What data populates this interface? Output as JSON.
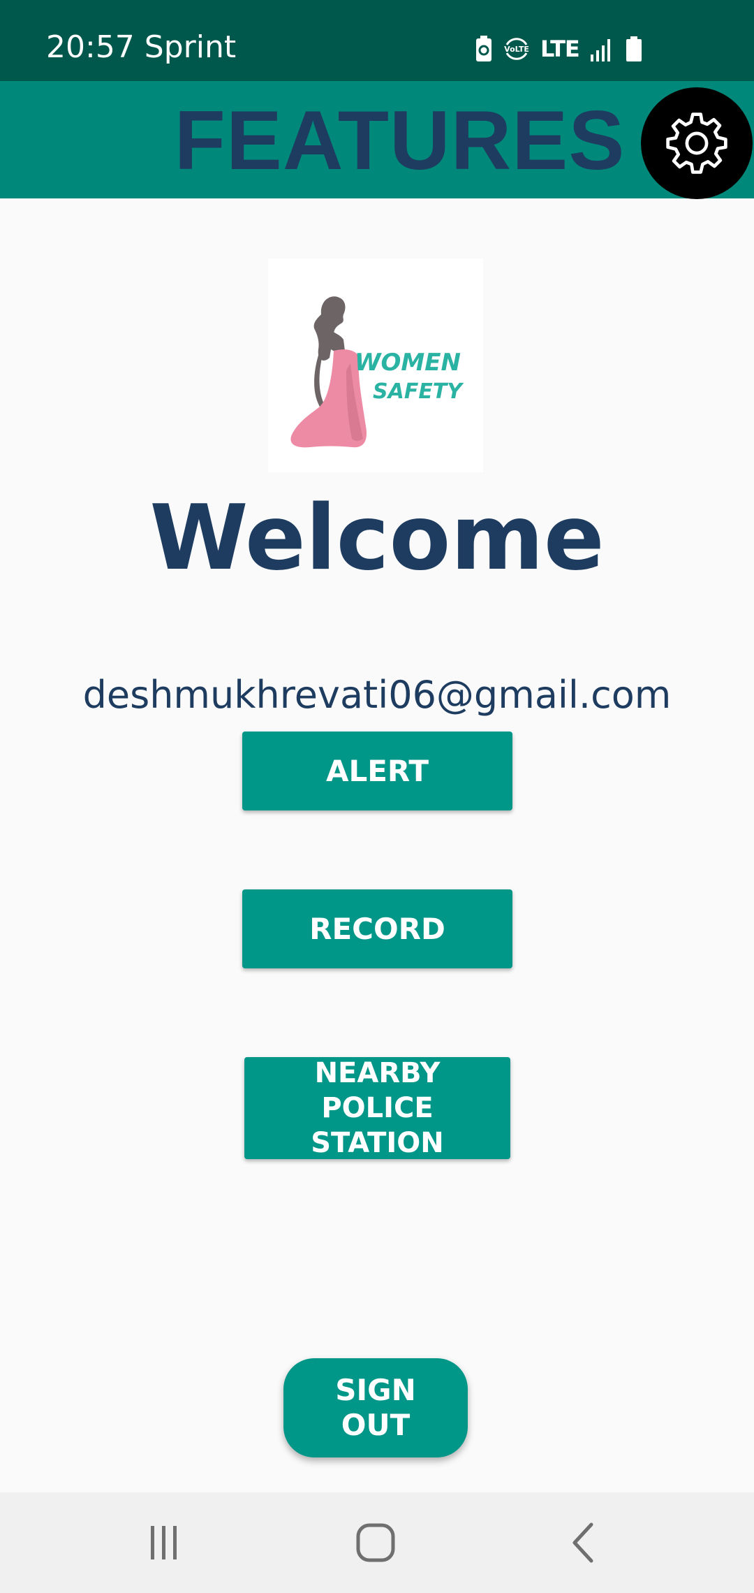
{
  "status_bar": {
    "time": "20:57 Sprint",
    "network": "LTE",
    "icons": [
      "battery-saver-icon",
      "volte-icon",
      "lte-icon",
      "signal-icon",
      "battery-icon"
    ]
  },
  "app_bar": {
    "title": "FEATURES",
    "settings_icon": "gear-icon"
  },
  "logo": {
    "line1": "WOMEN",
    "line2": "SAFETY"
  },
  "main": {
    "welcome": "Welcome",
    "email": "deshmukhrevati06@gmail.com",
    "alert_label": "ALERT",
    "record_label": "RECORD",
    "police_label": "NEARBY POLICE STATION",
    "sign_out_label": "SIGN OUT"
  },
  "nav_bar": {
    "icons": [
      "recent-apps-icon",
      "home-icon",
      "back-icon"
    ]
  },
  "colors": {
    "status_bar": "#00574b",
    "app_bar": "#00897b",
    "button": "#009688",
    "title_text": "#1d3c5f",
    "background": "#fafafa"
  }
}
